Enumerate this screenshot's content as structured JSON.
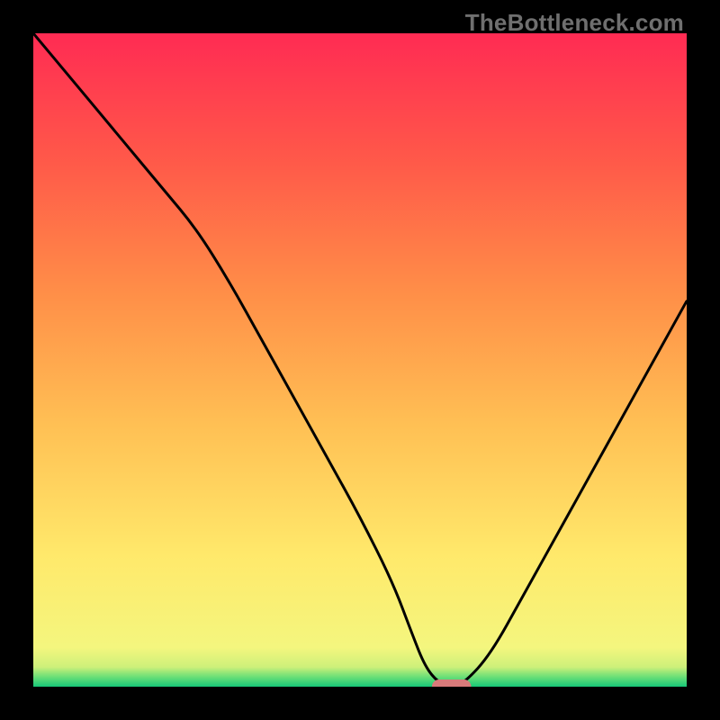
{
  "watermark": "TheBottleneck.com",
  "chart_data": {
    "type": "line",
    "title": "",
    "xlabel": "",
    "ylabel": "",
    "xlim": [
      0,
      100
    ],
    "ylim": [
      0,
      100
    ],
    "grid": false,
    "annotations": [],
    "background": {
      "type": "vertical-gradient",
      "domain_axis": "y",
      "stops": [
        {
          "y": 0,
          "color": "#16c778"
        },
        {
          "y": 1.5,
          "color": "#6bdf77"
        },
        {
          "y": 3,
          "color": "#cdf07a"
        },
        {
          "y": 6,
          "color": "#f4f67e"
        },
        {
          "y": 20,
          "color": "#ffe96b"
        },
        {
          "y": 40,
          "color": "#ffc054"
        },
        {
          "y": 60,
          "color": "#ff8f48"
        },
        {
          "y": 80,
          "color": "#ff5a49"
        },
        {
          "y": 100,
          "color": "#ff2b53"
        }
      ]
    },
    "series": [
      {
        "name": "bottleneck-curve",
        "color": "#000000",
        "x": [
          0,
          5,
          10,
          15,
          20,
          25,
          30,
          35,
          40,
          45,
          50,
          55,
          58,
          60,
          62,
          64,
          66,
          70,
          75,
          80,
          85,
          90,
          95,
          100
        ],
        "y": [
          100,
          94,
          88,
          82,
          76,
          70,
          62,
          53,
          44,
          35,
          26,
          16,
          8,
          3,
          0.6,
          0,
          0.6,
          5,
          14,
          23,
          32,
          41,
          50,
          59
        ]
      }
    ],
    "marker": {
      "name": "optimal-point",
      "shape": "capsule",
      "color": "#d87a7a",
      "x": 64,
      "y": 0,
      "width_x_units": 6,
      "height_y_units": 2.2
    }
  }
}
